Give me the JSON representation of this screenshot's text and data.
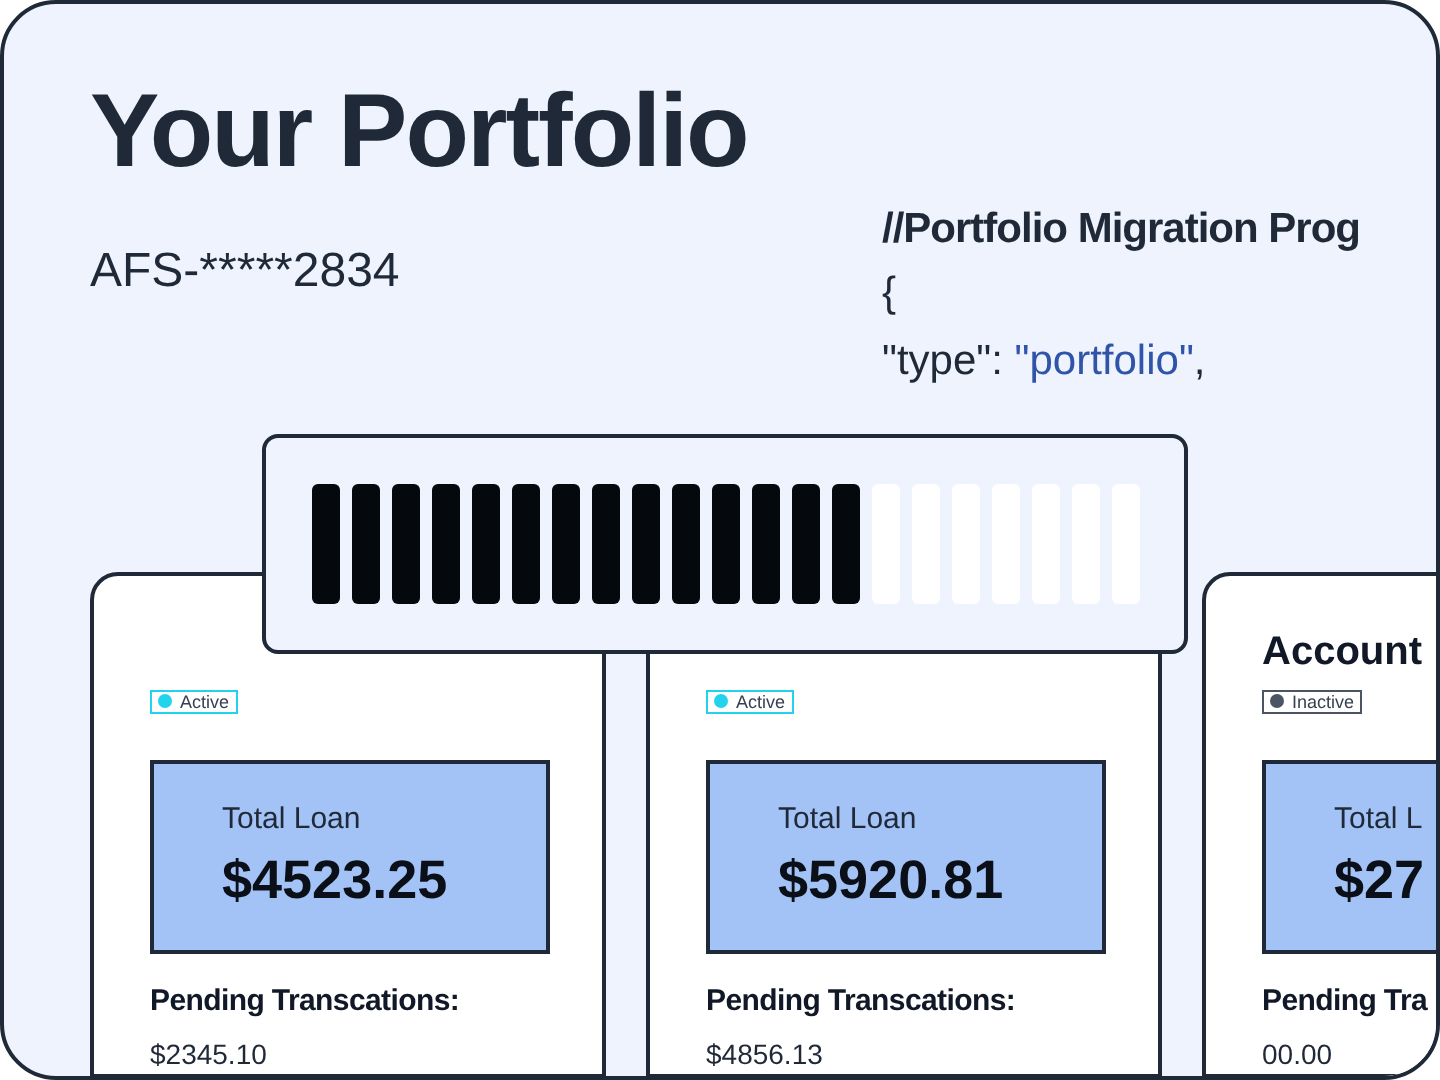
{
  "title": "Your Portfolio",
  "account_number": "AFS-*****2834",
  "code": {
    "title": "//Portfolio Migration Prog",
    "lines": [
      {
        "parts": [
          {
            "text": "{",
            "kind": "plain"
          }
        ]
      },
      {
        "parts": [
          {
            "text": "\"type\": ",
            "kind": "plain"
          },
          {
            "text": "\"portfolio\"",
            "kind": "string"
          },
          {
            "text": ",",
            "kind": "plain"
          }
        ]
      }
    ]
  },
  "progress": {
    "level": 0.6667
  },
  "cards": [
    {
      "status": "Active",
      "color": "#22d3ee",
      "loan_label": "Total Loan",
      "loan": "$4523.25",
      "pending_label": "Pending Transcations:",
      "pending": "$2345.10"
    },
    {
      "status": "Active",
      "color": "#22d3ee",
      "loan_label": "Total Loan",
      "loan": "$5920.81",
      "pending_label": "Pending Transcations:",
      "pending": "$4856.13"
    },
    {
      "title": "Account",
      "status": "Inactive",
      "color": "#4b5563",
      "loan_label": "Total L",
      "loan": "$27",
      "pending_label": "Pending Tra",
      "pending": "00.00"
    }
  ]
}
